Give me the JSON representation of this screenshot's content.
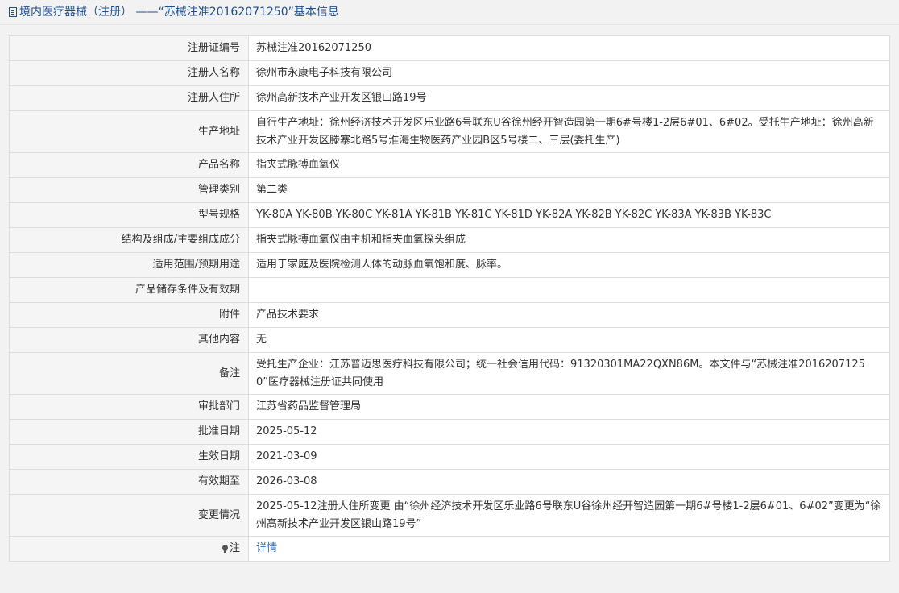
{
  "page": {
    "title": "境内医疗器械（注册） ——“苏械注准20162071250”基本信息"
  },
  "rows": [
    {
      "label": "注册证编号",
      "value": "苏械注准20162071250"
    },
    {
      "label": "注册人名称",
      "value": "徐州市永康电子科技有限公司"
    },
    {
      "label": "注册人住所",
      "value": "徐州高新技术产业开发区银山路19号"
    },
    {
      "label": "生产地址",
      "value": "自行生产地址：徐州经济技术开发区乐业路6号联东U谷徐州经开智造园第一期6#号楼1-2层6#01、6#02。受托生产地址：徐州高新技术产业开发区滕寨北路5号淮海生物医药产业园B区5号楼二、三层(委托生产)"
    },
    {
      "label": "产品名称",
      "value": "指夹式脉搏血氧仪"
    },
    {
      "label": "管理类别",
      "value": "第二类"
    },
    {
      "label": "型号规格",
      "value": "YK-80A YK-80B YK-80C YK-81A YK-81B YK-81C YK-81D YK-82A YK-82B YK-82C YK-83A YK-83B YK-83C"
    },
    {
      "label": "结构及组成/主要组成成分",
      "value": "指夹式脉搏血氧仪由主机和指夹血氧探头组成"
    },
    {
      "label": "适用范围/预期用途",
      "value": "适用于家庭及医院检测人体的动脉血氧饱和度、脉率。"
    },
    {
      "label": "产品储存条件及有效期",
      "value": ""
    },
    {
      "label": "附件",
      "value": "产品技术要求"
    },
    {
      "label": "其他内容",
      "value": "无"
    },
    {
      "label": "备注",
      "value": "受托生产企业：江苏普迈思医疗科技有限公司；统一社会信用代码：91320301MA22QXN86M。本文件与“苏械注准20162071250”医疗器械注册证共同使用"
    },
    {
      "label": "审批部门",
      "value": "江苏省药品监督管理局"
    },
    {
      "label": "批准日期",
      "value": "2025-05-12"
    },
    {
      "label": "生效日期",
      "value": "2021-03-09"
    },
    {
      "label": "有效期至",
      "value": "2026-03-08"
    },
    {
      "label": "变更情况",
      "value": "2025-05-12注册人住所变更 由“徐州经济技术开发区乐业路6号联东U谷徐州经开智造园第一期6#号楼1-2层6#01、6#02”变更为“徐州高新技术产业开发区银山路19号”"
    }
  ],
  "note": {
    "label": "注",
    "link_text": "详情",
    "icon": "bulb-icon"
  },
  "colors": {
    "title": "#1f4e8c",
    "link": "#2a6ebb",
    "label_bg": "#f5f5f5",
    "border": "#dddddd"
  }
}
